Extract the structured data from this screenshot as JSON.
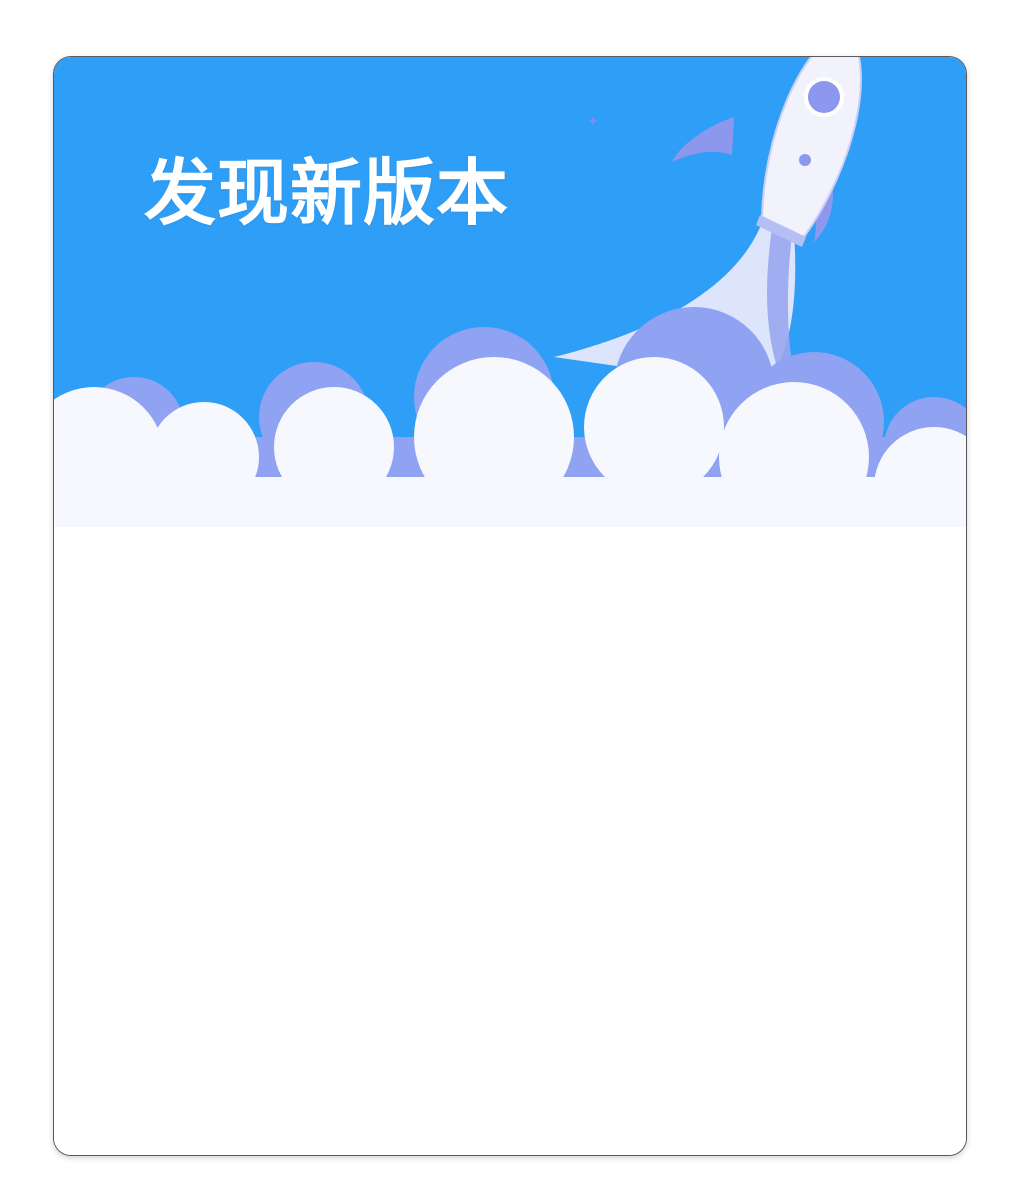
{
  "dialog": {
    "title": "发现新版本"
  },
  "icons": {
    "rocket": "rocket-icon",
    "clouds": "clouds-illustration",
    "sparkle": "sparkle-icon"
  },
  "colors": {
    "header_blue": "#2f9ef6",
    "cloud_back": "#8fa3f2",
    "cloud_front": "#f7f8fd",
    "rocket_body": "#f1f2fb",
    "rocket_accent": "#8b98ee"
  }
}
